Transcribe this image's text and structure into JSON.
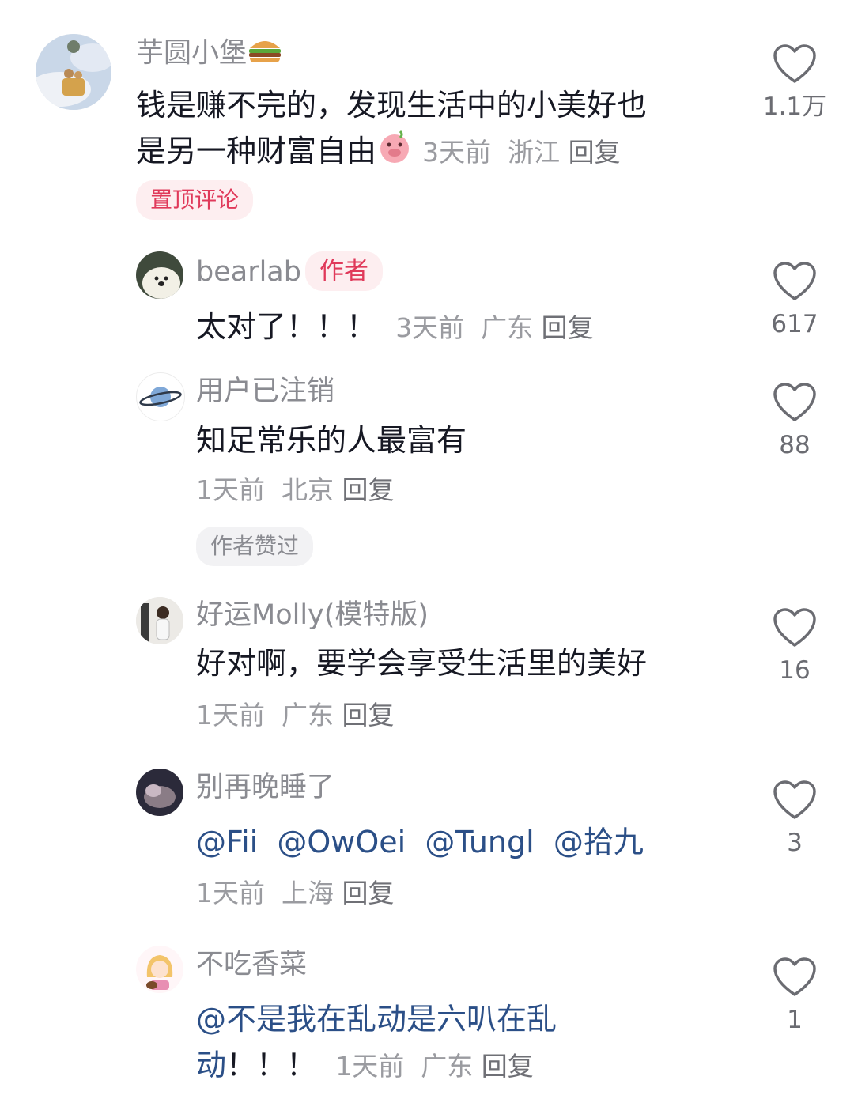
{
  "comments": [
    {
      "username": "芋圆小堡",
      "text_line1": "钱是赚不完的，发现生活中的小美好也",
      "text_line2": "是另一种财富自由",
      "time": "3天前",
      "location": "浙江",
      "reply": "回复",
      "badge": "置顶评论",
      "likes": "1.1万"
    },
    {
      "username": "bearlab",
      "author_tag": "作者",
      "text": "太对了！！！",
      "time": "3天前",
      "location": "广东",
      "reply": "回复",
      "likes": "617"
    },
    {
      "username": "用户已注销",
      "text": "知足常乐的人最富有",
      "time": "1天前",
      "location": "北京",
      "reply": "回复",
      "badge": "作者赞过",
      "likes": "88"
    },
    {
      "username": "好运Molly(模特版)",
      "text": "好对啊，要学会享受生活里的美好",
      "time": "1天前",
      "location": "广东",
      "reply": "回复",
      "likes": "16"
    },
    {
      "username": "别再晚睡了",
      "mentions": [
        "@Fii",
        "@OwOei",
        "@Tungl",
        "@拾九"
      ],
      "time": "1天前",
      "location": "上海",
      "reply": "回复",
      "likes": "3"
    },
    {
      "username": "不吃香菜",
      "mention_line1": "@不是我在乱动是六叭在乱",
      "mention_line2": "动",
      "text_tail": "！！！",
      "time": "1天前",
      "location": "广东",
      "reply": "回复",
      "likes": "1"
    }
  ],
  "icons": {
    "like": "heart-outline-icon"
  },
  "colors": {
    "pin_badge": "#e0395a",
    "mention": "#2b4f87",
    "meta": "#9a9ba0"
  }
}
